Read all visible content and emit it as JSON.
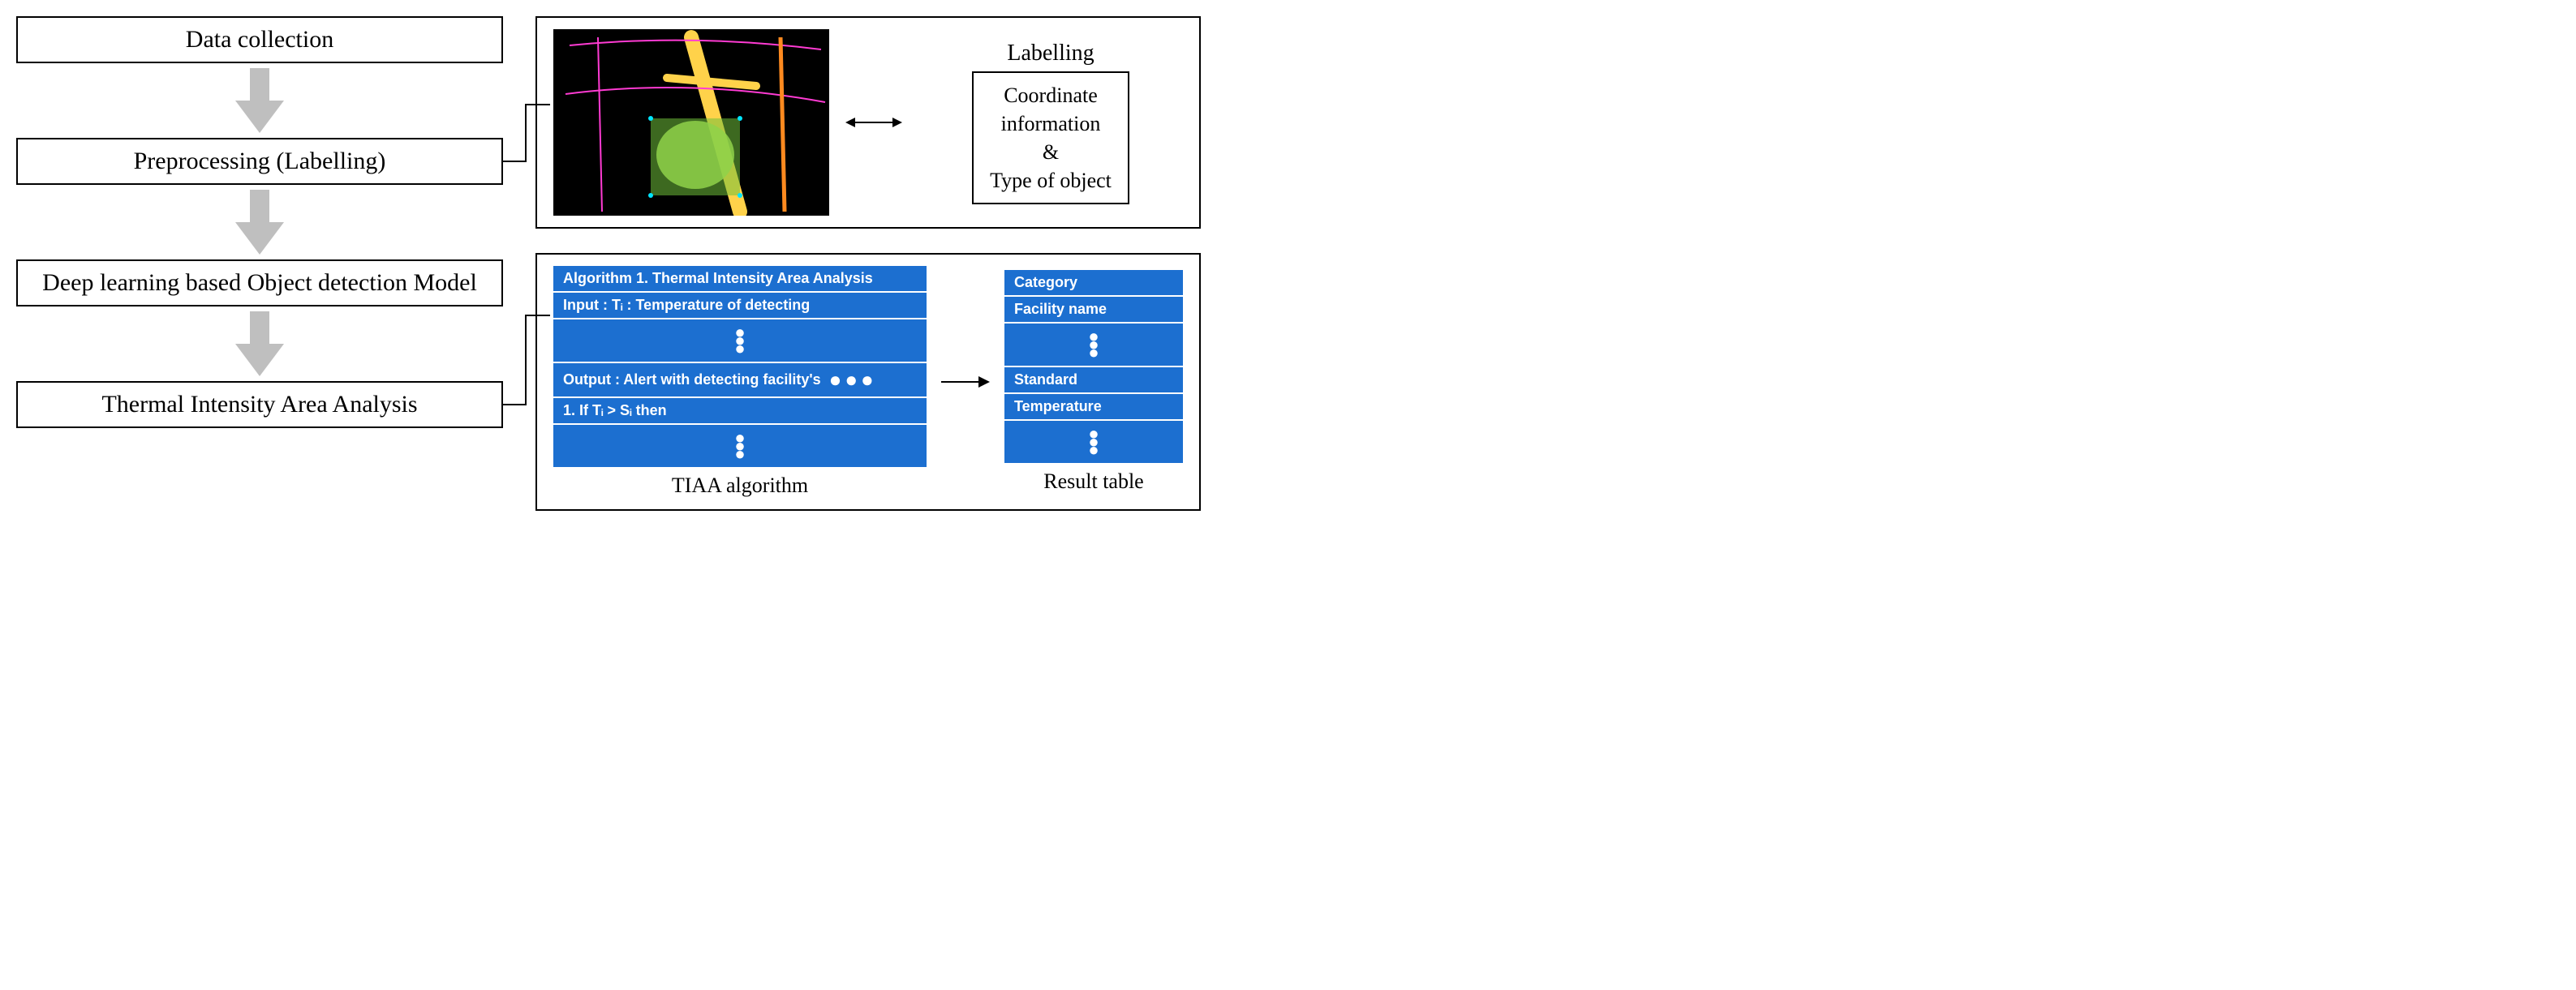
{
  "flow": {
    "step1": "Data collection",
    "step2": "Preprocessing (Labelling)",
    "step3": "Deep learning based Object detection Model",
    "step4": "Thermal Intensity Area Analysis"
  },
  "panel1": {
    "title": "Labelling",
    "box_line1": "Coordinate",
    "box_line2": "information",
    "box_line3": "&",
    "box_line4": "Type of object"
  },
  "panel2": {
    "algo": {
      "row1": "Algorithm 1. Thermal Intensity Area Analysis",
      "row2": "Input : Tᵢ : Temperature of detecting",
      "row3": "Output : Alert with detecting facility's",
      "row4": "1.      If Tᵢ > Sᵢ then",
      "caption": "TIAA algorithm"
    },
    "result": {
      "row1": "Category",
      "row2": "Facility name",
      "row3": "Standard",
      "row4": "Temperature",
      "caption": "Result table"
    }
  },
  "chart_data": {
    "type": "flowchart",
    "nodes": [
      {
        "id": "n1",
        "label": "Data collection"
      },
      {
        "id": "n2",
        "label": "Preprocessing (Labelling)"
      },
      {
        "id": "n3",
        "label": "Deep learning based Object detection Model"
      },
      {
        "id": "n4",
        "label": "Thermal Intensity Area Analysis"
      },
      {
        "id": "p1",
        "label": "Labelling detail (thermal image ↔ Coordinate information & Type of object)"
      },
      {
        "id": "p2",
        "label": "TIAA algorithm → Result table"
      }
    ],
    "edges": [
      {
        "from": "n1",
        "to": "n2",
        "style": "thick-gray-arrow"
      },
      {
        "from": "n2",
        "to": "n3",
        "style": "thick-gray-arrow"
      },
      {
        "from": "n3",
        "to": "n4",
        "style": "thick-gray-arrow"
      },
      {
        "from": "n2",
        "to": "p1",
        "style": "thin-elbow"
      },
      {
        "from": "n4",
        "to": "p2",
        "style": "thin-elbow"
      },
      {
        "from": "p1.image",
        "to": "p1.labelbox",
        "style": "double-arrow"
      },
      {
        "from": "p2.algo",
        "to": "p2.result",
        "style": "single-arrow"
      }
    ]
  }
}
